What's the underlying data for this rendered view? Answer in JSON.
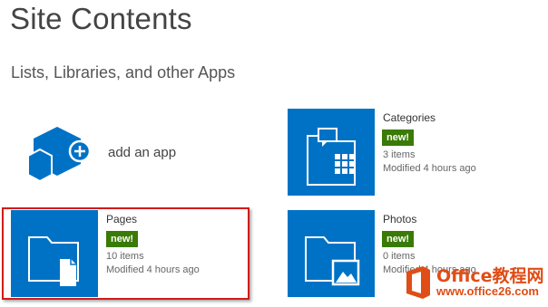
{
  "header": {
    "title": "Site Contents",
    "section_title": "Lists, Libraries, and other Apps"
  },
  "add_app": {
    "label": "add an app"
  },
  "apps": [
    {
      "title": "Categories",
      "badge": "new!",
      "count": "3 items",
      "modified": "Modified 4 hours ago",
      "icon": "folder-grid-icon"
    },
    {
      "title": "Pages",
      "badge": "new!",
      "count": "10 items",
      "modified": "Modified 4 hours ago",
      "icon": "folder-page-icon"
    },
    {
      "title": "Photos",
      "badge": "new!",
      "count": "0 items",
      "modified": "Modified 4 hours ago",
      "icon": "folder-image-icon"
    }
  ],
  "watermark": {
    "line1": "Office教程网",
    "line2": "www.office26.com"
  },
  "colors": {
    "tile": "#0072c6",
    "badge": "#3a7a06",
    "highlight": "#d11b1b",
    "watermark": "#e04d16"
  }
}
